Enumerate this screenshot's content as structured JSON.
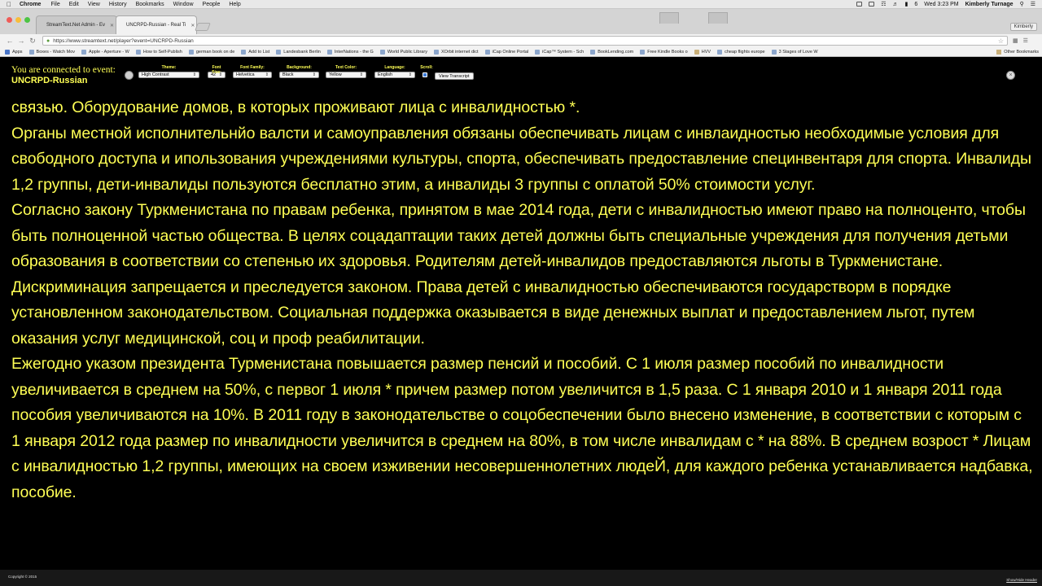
{
  "menubar": {
    "app_name": "Chrome",
    "items": [
      "File",
      "Edit",
      "View",
      "History",
      "Bookmarks",
      "Window",
      "People",
      "Help"
    ],
    "battery": "6",
    "datetime": "Wed 3:23 PM",
    "user": "Kimberly Turnage"
  },
  "tabs": [
    {
      "title": "StreamText.Net Admin - Ev"
    },
    {
      "title": "UNCRPD-Russian - Real Ti"
    }
  ],
  "profile_button": "Kimberly",
  "omnibox": {
    "url": "https://www.streamtext.net/player?event=UNCRPD-Russian"
  },
  "bookmarks": [
    {
      "label": "Apps",
      "kind": "apps"
    },
    {
      "label": "Boxes - Watch Mov",
      "kind": "page"
    },
    {
      "label": "Apple - Aperture - W",
      "kind": "page"
    },
    {
      "label": "How to Self-Publish",
      "kind": "page"
    },
    {
      "label": "german book on de",
      "kind": "page"
    },
    {
      "label": "Add to List",
      "kind": "page"
    },
    {
      "label": "Landesbank Berlin",
      "kind": "page"
    },
    {
      "label": "InterNations - the G",
      "kind": "page"
    },
    {
      "label": "World Public Library",
      "kind": "page"
    },
    {
      "label": "XOrbit internet dict",
      "kind": "page"
    },
    {
      "label": "iCap Online Portal",
      "kind": "page"
    },
    {
      "label": "iCap™ System - Sch",
      "kind": "page"
    },
    {
      "label": "BookLending.com",
      "kind": "page"
    },
    {
      "label": "Free Kindle Books o",
      "kind": "page"
    },
    {
      "label": "HVV",
      "kind": "folder"
    },
    {
      "label": "cheap flights europe",
      "kind": "page"
    },
    {
      "label": "3 Stages of Love W",
      "kind": "page"
    }
  ],
  "other_bookmarks": "Other Bookmarks",
  "player": {
    "connected_label": "You are connected to event:",
    "event_name": "UNCRPD-Russian",
    "controls": [
      {
        "label": "Theme:",
        "value": "High Contrast"
      },
      {
        "label": "Font Size:",
        "value": "42"
      },
      {
        "label": "Font Family:",
        "value": "Helvetica"
      },
      {
        "label": "Background:",
        "value": "Black"
      },
      {
        "label": "Text Color:",
        "value": "Yellow"
      },
      {
        "label": "Language:",
        "value": "English"
      }
    ],
    "scroll_label": "Scroll:",
    "scroll_checked": true,
    "view_transcript": "View Transcript",
    "text_color": "#ffff55",
    "background_color": "#000000"
  },
  "transcript": {
    "paragraphs": [
      "связью. Оборудование домов, в которых проживают лица с инвалидностью *.",
      "Органы местной исполнительнйо валсти и самоуправления обязаны обеспечивать лицам с инвлаидностью необходимые условия для свободного доступа и ипользования учреждениями культуры, спорта, обеспечивать предоставление специнвентаря для спорта. Инвалиды 1,2 группы, дети-инвалиды пользуются бесплатно этим, а инвалиды 3 группы с оплатой 50% стоимости услуг.",
      "Согласно закону Туркменистана по правам ребенка, принятом в мае 2014 года, дети с инвалидностью имеют право на полноценто, чтобы быть полноценной частью общества. В целях соцадаптации таких детей должны быть специальные учреждения для получения детьми образования в соответствии со степенью их здоровья. Родителям детей-инвалидов предоставляются льготы в Туркменистане. Дискриминация запрещается и преследуется законом. Права детей с инвалидностью обеспечиваются государстворм в порядке установленном законодательством. Социальная поддержка оказывается в виде денежных выплат и предоставлением льгот, путем оказания услуг медицинской, соц и проф реабилитации.",
      "Ежегодно указом президента Турменистана повышается размер пенсий и пособий. С 1 июля размер пособий по инвалидности увеличивается в среднем на 50%, с первог 1 июля * причем размер потом увеличится в 1,5 раза. С 1 января 2010 и 1 января 2011 года пособия увеличиваются на 10%. В 2011 году в законодательстве о соцобеспечении было внесено изменение, в соответствии с которым с 1 января 2012 года размер по инвалидности увеличится в среднем на 80%, в том числе инвалидам с * на 88%. В среднем возрост * Лицам с инвалидностью 1,2 группы, имеющих на своем изживении несовершеннолетних людеЙ, для каждого ребенка устанавливается надбавка, пособие."
    ]
  },
  "footer": {
    "copyright": "Copyright © 2015",
    "show_hide_header": "Show/Hide Header"
  }
}
